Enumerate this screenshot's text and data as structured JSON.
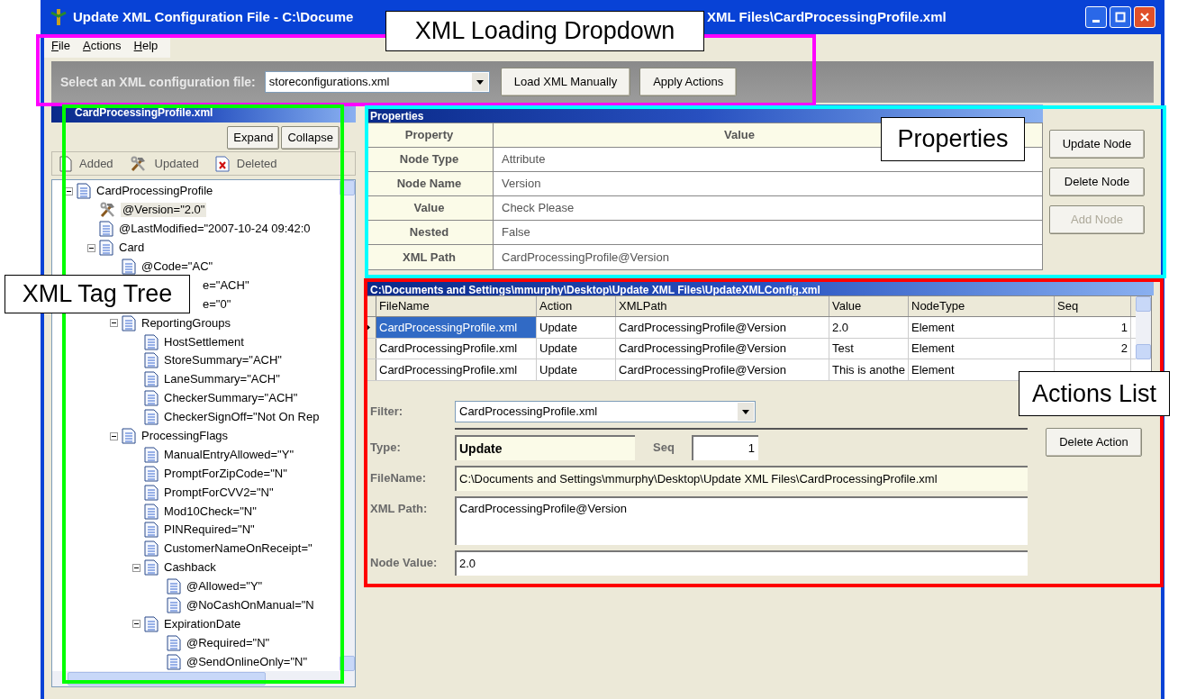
{
  "window": {
    "title_start": "Update XML Configuration File - C:\\Docume",
    "title_end": "XML Files\\CardProcessingProfile.xml"
  },
  "menu": [
    "File",
    "Actions",
    "Help"
  ],
  "toolbar": {
    "label": "Select an XML configuration file:",
    "combo_value": "storeconfigurations.xml",
    "buttons": [
      "Load XML Manually",
      "Apply Actions"
    ]
  },
  "tree_panel": {
    "title": "CardProcessingProfile.xml",
    "buttons": [
      "Expand",
      "Collapse"
    ],
    "legend": [
      {
        "kind": "added",
        "label": "Added"
      },
      {
        "kind": "updated",
        "label": "Updated"
      },
      {
        "kind": "deleted",
        "label": "Deleted"
      }
    ],
    "tree": [
      {
        "label": "CardProcessingProfile",
        "kind": "element",
        "selected": false,
        "expanded": true,
        "children": [
          {
            "label": "@Version=\"2.0\"",
            "kind": "updated",
            "selected": true
          },
          {
            "label": "@LastModified=\"2007-10-24 09:42:0",
            "kind": "element",
            "selected": false
          },
          {
            "label": "Card",
            "kind": "element",
            "selected": false,
            "expanded": true,
            "children": [
              {
                "label": "@Code=\"AC\"",
                "kind": "element",
                "selected": false
              },
              {
                "label": "e=\"ACH\"",
                "kind": "clipped",
                "selected": false
              },
              {
                "label": "e=\"0\"",
                "kind": "clipped",
                "selected": false
              },
              {
                "label": "ReportingGroups",
                "kind": "element",
                "selected": false,
                "expanded": true,
                "children": [
                  {
                    "label": "HostSettlement",
                    "kind": "element",
                    "selected": false
                  },
                  {
                    "label": "StoreSummary=\"ACH\"",
                    "kind": "element",
                    "selected": false
                  },
                  {
                    "label": "LaneSummary=\"ACH\"",
                    "kind": "element",
                    "selected": false
                  },
                  {
                    "label": "CheckerSummary=\"ACH\"",
                    "kind": "element",
                    "selected": false
                  },
                  {
                    "label": "CheckerSignOff=\"Not On Rep",
                    "kind": "element",
                    "selected": false
                  }
                ]
              },
              {
                "label": "ProcessingFlags",
                "kind": "element",
                "selected": false,
                "expanded": true,
                "children": [
                  {
                    "label": "ManualEntryAllowed=\"Y\"",
                    "kind": "element",
                    "selected": false
                  },
                  {
                    "label": "PromptForZipCode=\"N\"",
                    "kind": "element",
                    "selected": false
                  },
                  {
                    "label": "PromptForCVV2=\"N\"",
                    "kind": "element",
                    "selected": false
                  },
                  {
                    "label": "Mod10Check=\"N\"",
                    "kind": "element",
                    "selected": false
                  },
                  {
                    "label": "PINRequired=\"N\"",
                    "kind": "element",
                    "selected": false
                  },
                  {
                    "label": "CustomerNameOnReceipt=\"",
                    "kind": "element",
                    "selected": false
                  },
                  {
                    "label": "Cashback",
                    "kind": "element",
                    "selected": false,
                    "expanded": true,
                    "children": [
                      {
                        "label": "@Allowed=\"Y\"",
                        "kind": "element",
                        "selected": false
                      },
                      {
                        "label": "@NoCashOnManual=\"N",
                        "kind": "element",
                        "selected": false
                      }
                    ]
                  },
                  {
                    "label": "ExpirationDate",
                    "kind": "element",
                    "selected": false,
                    "expanded": true,
                    "children": [
                      {
                        "label": "@Required=\"N\"",
                        "kind": "element",
                        "selected": false
                      },
                      {
                        "label": "@SendOnlineOnly=\"N\"",
                        "kind": "element",
                        "selected": false
                      }
                    ]
                  }
                ]
              }
            ]
          }
        ]
      }
    ]
  },
  "properties": {
    "title": "Properties",
    "columns": [
      "Property",
      "Value"
    ],
    "rows": [
      [
        "Node Type",
        "Attribute"
      ],
      [
        "Node Name",
        "Version"
      ],
      [
        "Value",
        "Check Please"
      ],
      [
        "Nested",
        "False"
      ],
      [
        "XML Path",
        "CardProcessingProfile@Version"
      ]
    ],
    "buttons": [
      {
        "label": "Update Node",
        "disabled": false
      },
      {
        "label": "Delete Node",
        "disabled": false
      },
      {
        "label": "Add Node",
        "disabled": true
      }
    ]
  },
  "actions": {
    "title": "C:\\Documents and Settings\\mmurphy\\Desktop\\Update XML Files\\UpdateXMLConfig.xml",
    "columns": [
      "FileName",
      "Action",
      "XMLPath",
      "Value",
      "NodeType",
      "Seq"
    ],
    "rows": [
      {
        "cells": [
          "CardProcessingProfile.xml",
          "Update",
          "CardProcessingProfile@Version",
          "2.0",
          "Element",
          "1"
        ],
        "selected": true
      },
      {
        "cells": [
          "CardProcessingProfile.xml",
          "Update",
          "CardProcessingProfile@Version",
          "Test",
          "Element",
          "2"
        ],
        "selected": false
      },
      {
        "cells": [
          "CardProcessingProfile.xml",
          "Update",
          "CardProcessingProfile@Version",
          "This is anothe",
          "Element",
          ""
        ],
        "selected": false
      }
    ],
    "form": {
      "filter_label": "Filter:",
      "filter_value": "CardProcessingProfile.xml",
      "type_label": "Type:",
      "type_value": "Update",
      "seq_label": "Seq",
      "seq_value": "1",
      "filename_label": "FileName:",
      "filename_value": "C:\\Documents and Settings\\mmurphy\\Desktop\\Update XML Files\\CardProcessingProfile.xml",
      "xmlpath_label": "XML Path:",
      "xmlpath_value": "CardProcessingProfile@Version",
      "nodevalue_label": "Node Value:",
      "nodevalue_value": "2.0"
    },
    "button": "Delete Action"
  },
  "annotations": [
    {
      "label": "XML Loading Dropdown",
      "color": "#ff00ff"
    },
    {
      "label": "Properties",
      "color": "#00ffff"
    },
    {
      "label": "XML Tag Tree",
      "color": "#00ff00"
    },
    {
      "label": "Actions List",
      "color": "#ff0000"
    }
  ]
}
